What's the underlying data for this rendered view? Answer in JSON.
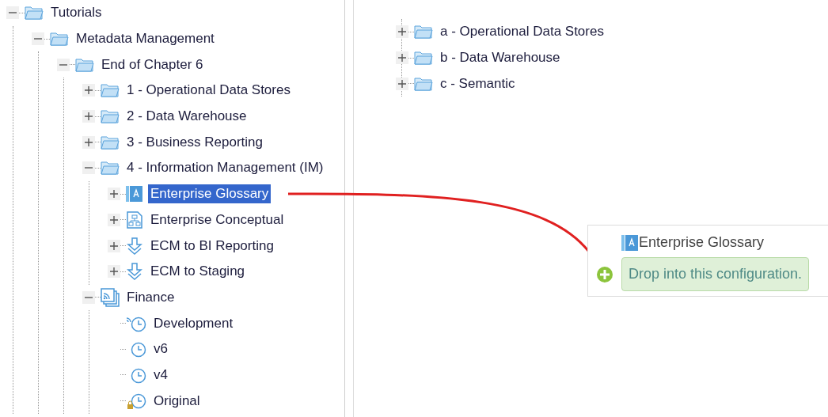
{
  "left_tree": [
    {
      "label": "Tutorials",
      "kind": "folder",
      "expanded": true,
      "selected": false,
      "children": [
        {
          "label": "Metadata Management",
          "kind": "folder",
          "expanded": true,
          "selected": false,
          "children": [
            {
              "label": "End of Chapter 6",
              "kind": "folder",
              "expanded": true,
              "selected": false,
              "children": [
                {
                  "label": "1 - Operational Data Stores",
                  "kind": "folder",
                  "expanded": false,
                  "selected": false
                },
                {
                  "label": "2 - Data Warehouse",
                  "kind": "folder",
                  "expanded": false,
                  "selected": false
                },
                {
                  "label": "3 - Business Reporting",
                  "kind": "folder",
                  "expanded": false,
                  "selected": false
                },
                {
                  "label": "4 - Information Management (IM)",
                  "kind": "folder",
                  "expanded": true,
                  "selected": false,
                  "children": [
                    {
                      "label": "Enterprise Glossary",
                      "kind": "glossary",
                      "expanded": false,
                      "selected": true
                    },
                    {
                      "label": "Enterprise Conceptual",
                      "kind": "diagram",
                      "expanded": false,
                      "selected": false
                    },
                    {
                      "label": "ECM to BI Reporting",
                      "kind": "mapping",
                      "expanded": false,
                      "selected": false
                    },
                    {
                      "label": "ECM to Staging",
                      "kind": "mapping",
                      "expanded": false,
                      "selected": false
                    }
                  ]
                },
                {
                  "label": "Finance",
                  "kind": "configuration",
                  "expanded": true,
                  "selected": false,
                  "children": [
                    {
                      "label": "Development",
                      "kind": "live-version",
                      "selected": false
                    },
                    {
                      "label": "v6",
                      "kind": "version",
                      "selected": false
                    },
                    {
                      "label": "v4",
                      "kind": "version",
                      "selected": false
                    },
                    {
                      "label": "Original",
                      "kind": "locked-version",
                      "selected": false
                    }
                  ]
                }
              ]
            }
          ]
        }
      ]
    }
  ],
  "right_tree": [
    {
      "label": "a - Operational Data Stores",
      "kind": "folder",
      "expanded": false,
      "selected": false
    },
    {
      "label": "b - Data Warehouse",
      "kind": "folder",
      "expanded": false,
      "selected": false
    },
    {
      "label": "c - Semantic",
      "kind": "folder",
      "expanded": false,
      "selected": false
    }
  ],
  "drop_tooltip": {
    "item": {
      "label": "Enterprise Glossary",
      "kind": "glossary"
    },
    "message": "Drop into this configuration."
  }
}
